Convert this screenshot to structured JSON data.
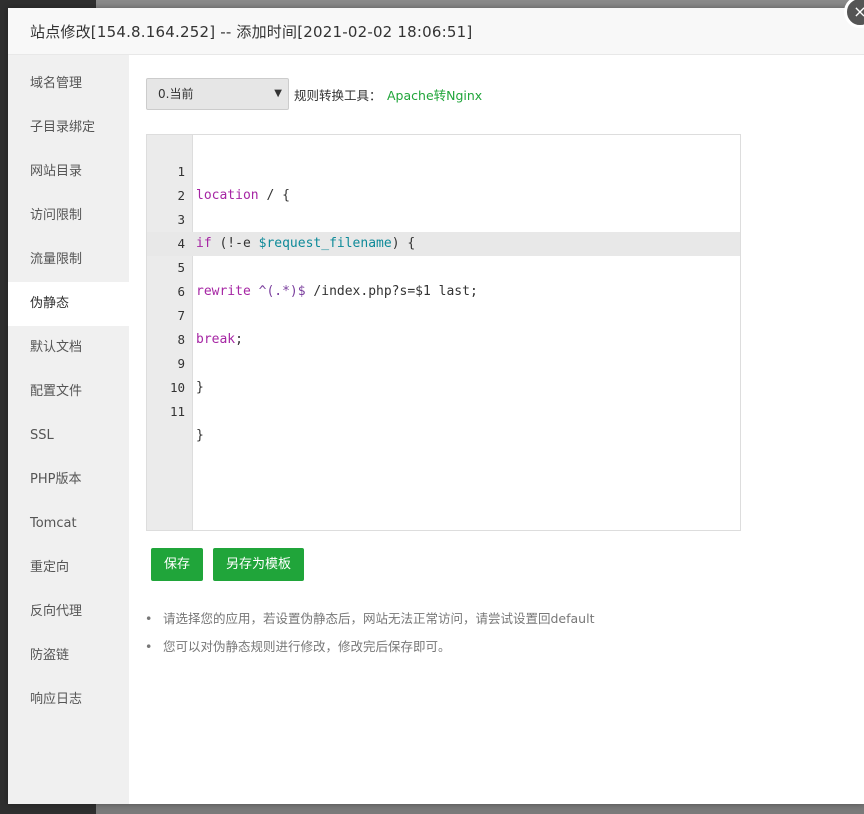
{
  "modal": {
    "title": "站点修改[154.8.164.252] -- 添加时间[2021-02-02 18:06:51]",
    "close_glyph": "×"
  },
  "sidebar": {
    "items": [
      {
        "label": "域名管理",
        "active": false
      },
      {
        "label": "子目录绑定",
        "active": false
      },
      {
        "label": "网站目录",
        "active": false
      },
      {
        "label": "访问限制",
        "active": false
      },
      {
        "label": "流量限制",
        "active": false
      },
      {
        "label": "伪静态",
        "active": true
      },
      {
        "label": "默认文档",
        "active": false
      },
      {
        "label": "配置文件",
        "active": false
      },
      {
        "label": "SSL",
        "active": false
      },
      {
        "label": "PHP版本",
        "active": false
      },
      {
        "label": "Tomcat",
        "active": false
      },
      {
        "label": "重定向",
        "active": false
      },
      {
        "label": "反向代理",
        "active": false
      },
      {
        "label": "防盗链",
        "active": false
      },
      {
        "label": "响应日志",
        "active": false
      }
    ]
  },
  "rewrite": {
    "selected_template": "0.当前",
    "tool_label": "规则转换工具：",
    "tool_link": "Apache转Nginx",
    "active_line": 5,
    "lines": [
      {
        "no": "1",
        "text": "location / {"
      },
      {
        "no": "2",
        "text": ""
      },
      {
        "no": "3",
        "text": "if (!-e $request_filename) {"
      },
      {
        "no": "4",
        "text": ""
      },
      {
        "no": "5",
        "text": "rewrite ^(.*)$ /index.php?s=$1 last;"
      },
      {
        "no": "6",
        "text": ""
      },
      {
        "no": "7",
        "text": "break;"
      },
      {
        "no": "8",
        "text": ""
      },
      {
        "no": "9",
        "text": "}"
      },
      {
        "no": "10",
        "text": ""
      },
      {
        "no": "11",
        "text": "}"
      }
    ],
    "save_label": "保存",
    "save_template_label": "另存为模板",
    "tips": [
      "请选择您的应用，若设置伪静态后，网站无法正常访问，请尝试设置回default",
      "您可以对伪静态规则进行修改，修改完后保存即可。"
    ]
  },
  "colors": {
    "accent": "#20a53a",
    "sidebar_bg": "#f0f0f0",
    "keyword": "#a626a4",
    "variable": "#0e8a99"
  }
}
